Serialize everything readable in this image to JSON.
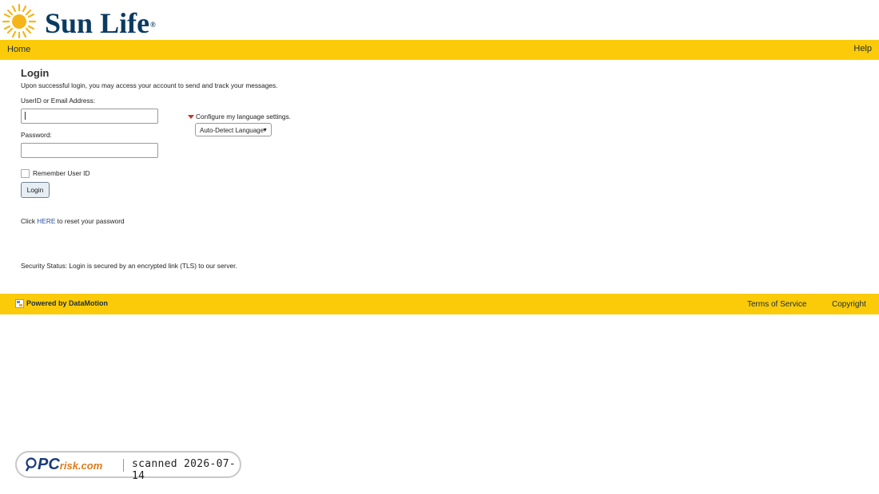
{
  "brand": {
    "name": "Sun Life",
    "reg_mark": "®",
    "accent_color": "#fbcb0a",
    "text_color": "#0b3b60"
  },
  "nav": {
    "home_label": "Home",
    "help_label": "Help"
  },
  "login": {
    "title": "Login",
    "intro": "Upon successful login, you may access your account to send and track your messages.",
    "user_label": "UserID or Email Address:",
    "user_value": "",
    "password_label": "Password:",
    "password_value": "",
    "remember_label": "Remember User ID",
    "remember_checked": false,
    "submit_label": "Login",
    "reset_prefix": "Click",
    "reset_link": "HERE",
    "reset_suffix": "to reset your password",
    "security_status": "Security Status: Login is secured by an encrypted link (TLS) to our server."
  },
  "language": {
    "toggle_label": "Configure my language settings.",
    "selected": "Auto-Detect Language"
  },
  "footer": {
    "powered_by": "Powered by DataMotion",
    "terms_label": "Terms of Service",
    "copyright_label": "Copyright"
  },
  "watermark": {
    "logo_pc": "PC",
    "logo_risk": "risk.com",
    "text": "scanned 2026-07-14"
  }
}
